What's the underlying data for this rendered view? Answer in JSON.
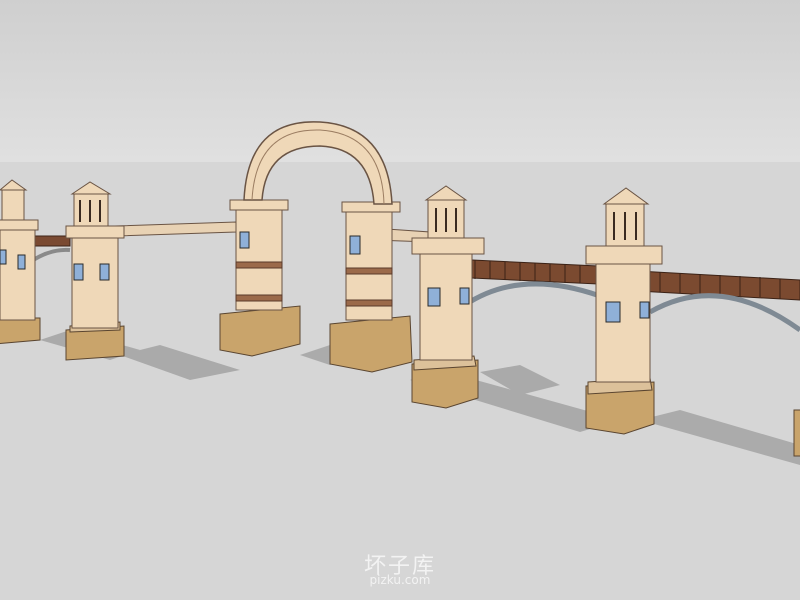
{
  "scene": {
    "description_label": "",
    "colors": {
      "sky_top": "#d0d0d0",
      "sky_bottom": "#dedede",
      "ground": "#d6d6d6",
      "stucco": "#efd8b8",
      "stucco_shade": "#d9bf9c",
      "band": "#9b6a4a",
      "base_stone": "#c9a46b",
      "base_stone_dark": "#b08952",
      "timber": "#7a4a32",
      "window_glass": "#8fb0d8",
      "shadow": "#9a9a9a",
      "arch_beam": "#8a8a8a"
    },
    "icons": [
      "pillar-icon",
      "arch-icon",
      "pergola-icon",
      "window-icon"
    ]
  },
  "watermark": {
    "main": "坏子库",
    "sub": "pizku.com"
  }
}
